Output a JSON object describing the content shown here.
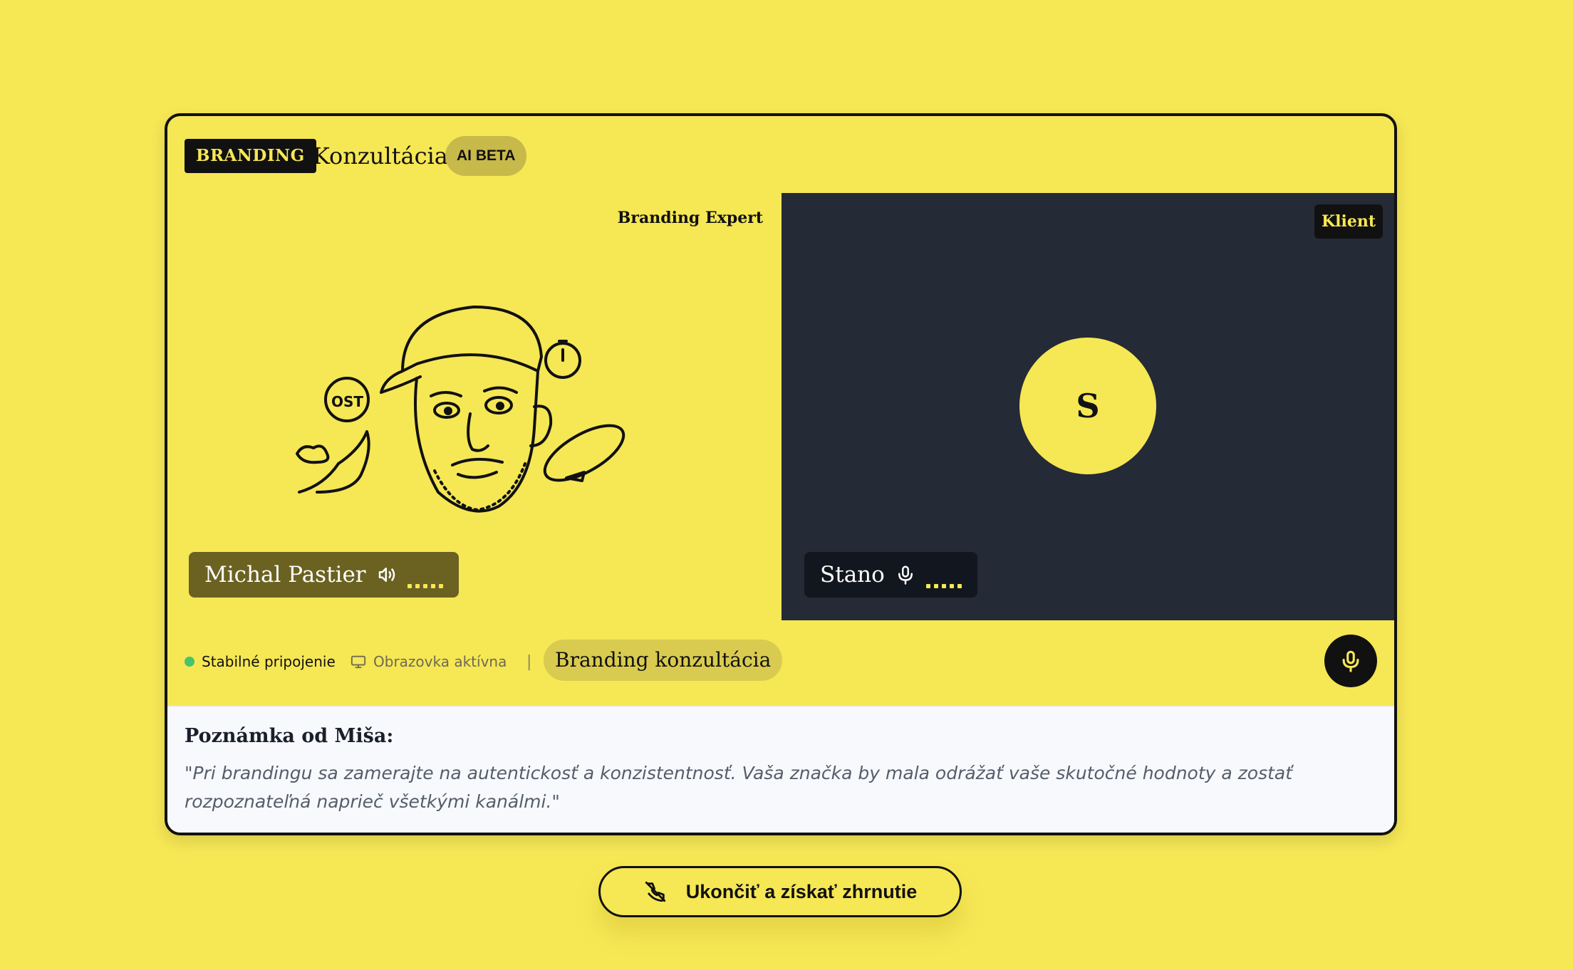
{
  "header": {
    "badge": "BRANDING",
    "title": "Konzultácia",
    "beta": "AI BETA"
  },
  "participants": {
    "expert": {
      "role": "Branding Expert",
      "name": "Michal Pastier",
      "sticker_text": "OST"
    },
    "client": {
      "role": "Klient",
      "initial": "S",
      "name": "Stano"
    }
  },
  "status": {
    "connection": "Stabilné pripojenie",
    "screen": "Obrazovka aktívna",
    "separator": "|",
    "session_label": "Branding konzultácia"
  },
  "note": {
    "title": "Poznámka od Miša:",
    "text": "\"Pri brandingu sa zamerajte na autentickosť a konzistentnosť. Vaša značka by mala odrážať vaše skutočné hodnoty a zostať rozpoznateľná naprieč všetkými kanálmi.\""
  },
  "actions": {
    "end_label": "Ukončiť a získať zhrnutie"
  },
  "colors": {
    "accent": "#f6e755",
    "dark": "#111111",
    "client_bg": "#242a36",
    "connection_ok": "#46c46a"
  }
}
